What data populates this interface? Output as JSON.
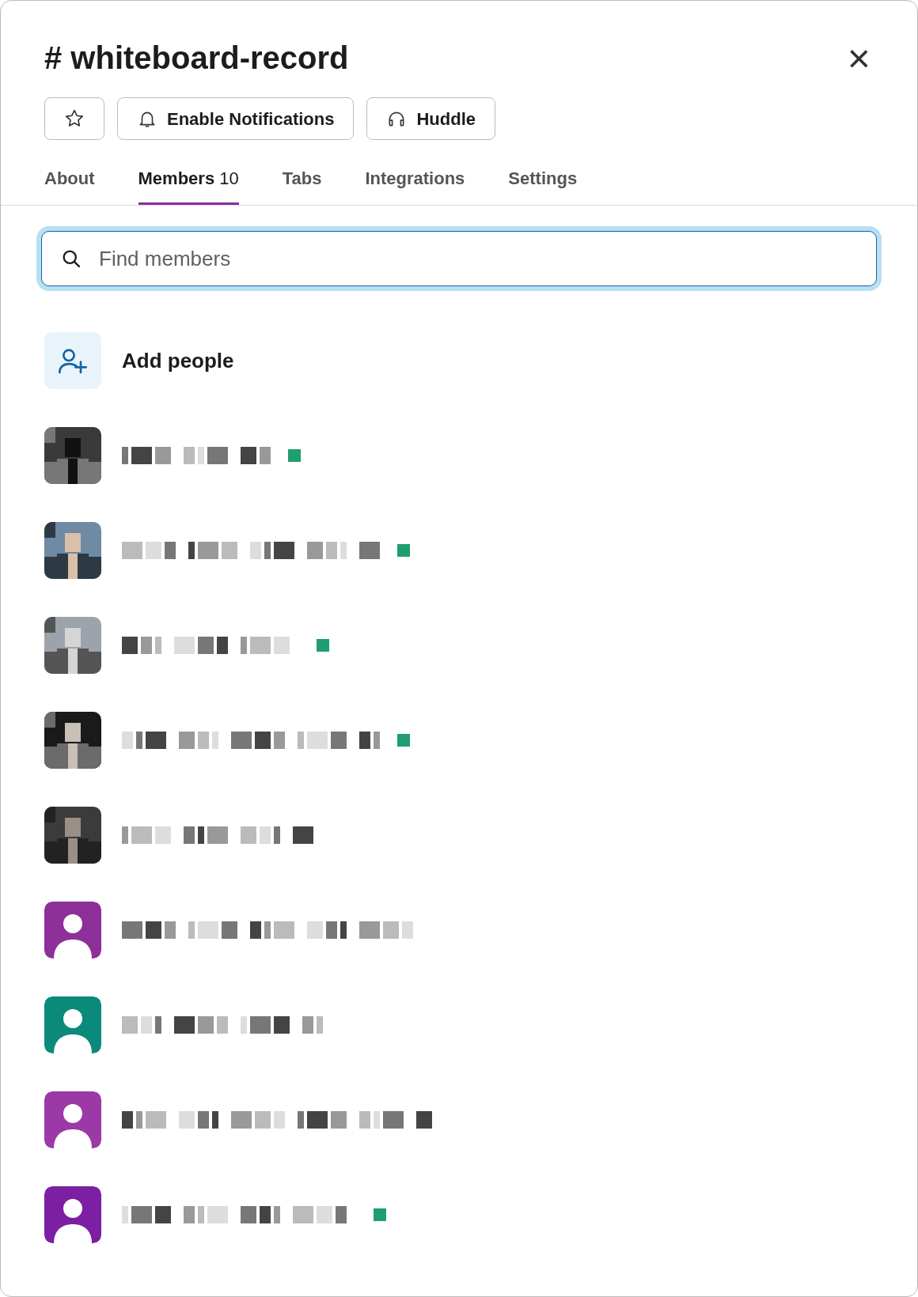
{
  "channel": {
    "prefix": "#",
    "name": "whiteboard-record"
  },
  "close": "×",
  "actions": [
    {
      "kind": "star"
    },
    {
      "kind": "bell",
      "label": "Enable Notifications"
    },
    {
      "kind": "headphones",
      "label": "Huddle"
    }
  ],
  "tabs": [
    {
      "label": "About",
      "selected": false
    },
    {
      "label": "Members",
      "count": "10",
      "selected": true
    },
    {
      "label": "Tabs",
      "selected": false
    },
    {
      "label": "Integrations",
      "selected": false
    },
    {
      "label": "Settings",
      "selected": false
    }
  ],
  "search": {
    "placeholder": "Find members"
  },
  "add_people": "Add people",
  "members": [
    {
      "online": true
    },
    {
      "online": true
    },
    {
      "online": true
    },
    {
      "online": true
    },
    {
      "online": false
    },
    {
      "avatar": {
        "kind": "default",
        "color": "#8e3099"
      },
      "online": false
    },
    {
      "avatar": {
        "kind": "default",
        "color": "#0b8a7b"
      },
      "online": false
    },
    {
      "avatar": {
        "kind": "default",
        "color": "#9b3aa6"
      },
      "online": false
    },
    {
      "avatar": {
        "kind": "default",
        "color": "#7c1fa3"
      },
      "online": true
    }
  ]
}
